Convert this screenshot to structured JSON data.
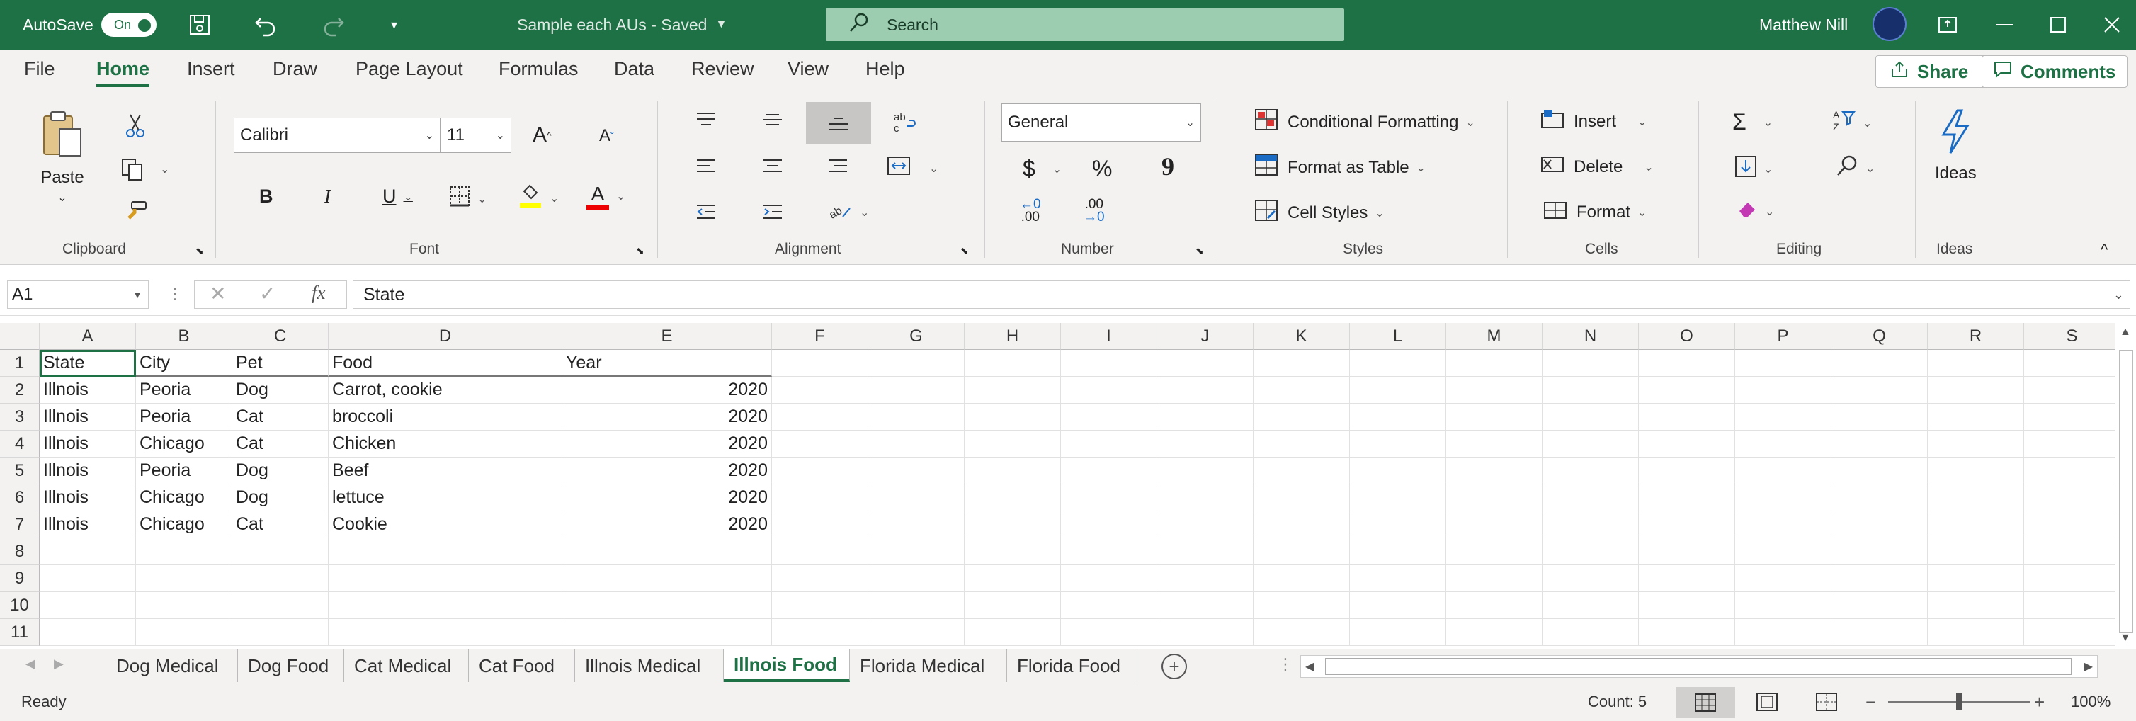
{
  "titlebar": {
    "autosave_label": "AutoSave",
    "autosave_state": "On",
    "doc_title": "Sample each AUs  -  Saved",
    "search_placeholder": "Search",
    "user_name": "Matthew Nill"
  },
  "menu": {
    "tabs": [
      "File",
      "Home",
      "Insert",
      "Draw",
      "Page Layout",
      "Formulas",
      "Data",
      "Review",
      "View",
      "Help"
    ],
    "active": "Home",
    "share_label": "Share",
    "comments_label": "Comments"
  },
  "ribbon": {
    "clipboard": {
      "paste_label": "Paste",
      "group_label": "Clipboard"
    },
    "font": {
      "font_name": "Calibri",
      "font_size": "11",
      "bold": "B",
      "italic": "I",
      "underline": "U",
      "grow": "A",
      "shrink": "A",
      "font_color": "A",
      "group_label": "Font"
    },
    "alignment": {
      "group_label": "Alignment"
    },
    "number": {
      "format": "General",
      "currency": "$",
      "percent": "%",
      "comma": "9",
      "inc_decimal": ".00",
      "dec_decimal": ".00",
      "group_label": "Number"
    },
    "styles": {
      "conditional": "Conditional Formatting",
      "table": "Format as Table",
      "cell_styles": "Cell Styles",
      "group_label": "Styles"
    },
    "cells": {
      "insert": "Insert",
      "delete": "Delete",
      "format": "Format",
      "group_label": "Cells"
    },
    "editing": {
      "group_label": "Editing"
    },
    "ideas": {
      "label": "Ideas",
      "group_label": "Ideas"
    }
  },
  "formula_bar": {
    "name_box": "A1",
    "fx": "fx",
    "content": "State"
  },
  "grid": {
    "columns": [
      "A",
      "B",
      "C",
      "D",
      "E",
      "F",
      "G",
      "H",
      "I",
      "J",
      "K",
      "L",
      "M",
      "N",
      "O",
      "P",
      "Q",
      "R",
      "S"
    ],
    "rows": [
      [
        "State",
        "City",
        "Pet",
        "Food",
        "Year"
      ],
      [
        "Illnois",
        "Peoria",
        "Dog",
        "Carrot, cookie",
        "2020"
      ],
      [
        "Illnois",
        "Peoria",
        "Cat",
        "broccoli",
        "2020"
      ],
      [
        "Illnois",
        "Chicago",
        "Cat",
        "Chicken",
        "2020"
      ],
      [
        "Illnois",
        "Peoria",
        "Dog",
        "Beef",
        "2020"
      ],
      [
        "Illnois",
        "Chicago",
        "Dog",
        "lettuce",
        "2020"
      ],
      [
        "Illnois",
        "Chicago",
        "Cat",
        "Cookie",
        "2020"
      ],
      [
        "",
        "",
        "",
        "",
        ""
      ],
      [
        "",
        "",
        "",
        "",
        ""
      ],
      [
        "",
        "",
        "",
        "",
        ""
      ],
      [
        "",
        "",
        "",
        "",
        ""
      ]
    ]
  },
  "sheet_tabs": [
    "Dog Medical",
    "Dog Food",
    "Cat Medical",
    "Cat Food",
    "Illnois Medical",
    "Illnois Food",
    "Florida Medical",
    "Florida Food"
  ],
  "active_sheet": "Illnois Food",
  "status": {
    "ready": "Ready",
    "count": "Count: 5",
    "zoom": "100%"
  }
}
